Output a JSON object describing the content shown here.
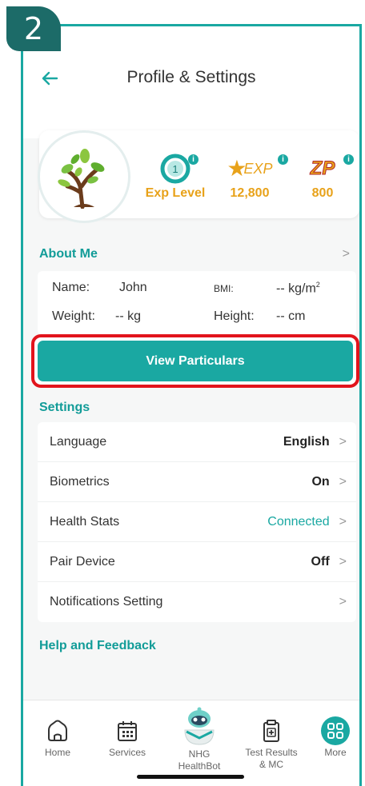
{
  "step_number": "2",
  "header": {
    "title": "Profile & Settings"
  },
  "stats": {
    "level": {
      "label": "Exp Level",
      "badge": "1"
    },
    "exp": {
      "icon_text": "EXP",
      "value": "12,800"
    },
    "zp": {
      "icon_text": "ZP",
      "value": "800"
    }
  },
  "about": {
    "title": "About Me",
    "name_label": "Name:",
    "name_value": "John",
    "bmi_label": "BMI:",
    "bmi_value": "-- kg/m",
    "bmi_sup": "2",
    "weight_label": "Weight:",
    "weight_value": "-- kg",
    "height_label": "Height:",
    "height_value": "-- cm"
  },
  "view_particulars_label": "View Particulars",
  "settings": {
    "title": "Settings",
    "items": [
      {
        "label": "Language",
        "value": "English"
      },
      {
        "label": "Biometrics",
        "value": "On"
      },
      {
        "label": "Health Stats",
        "value": "Connected"
      },
      {
        "label": "Pair Device",
        "value": "Off"
      },
      {
        "label": "Notifications Setting",
        "value": ""
      }
    ]
  },
  "help_title": "Help and Feedback",
  "tabs": [
    {
      "label": "Home",
      "icon": "home-icon"
    },
    {
      "label": "Services",
      "icon": "calendar-icon"
    },
    {
      "label": "NHG HealthBot",
      "icon": "healthbot-icon"
    },
    {
      "label": "Test Results & MC",
      "icon": "clipboard-icon"
    },
    {
      "label": "More",
      "icon": "grid-icon"
    }
  ],
  "colors": {
    "accent": "#1aa8a2",
    "highlight": "#e2141c",
    "gold": "#e8a21a"
  }
}
